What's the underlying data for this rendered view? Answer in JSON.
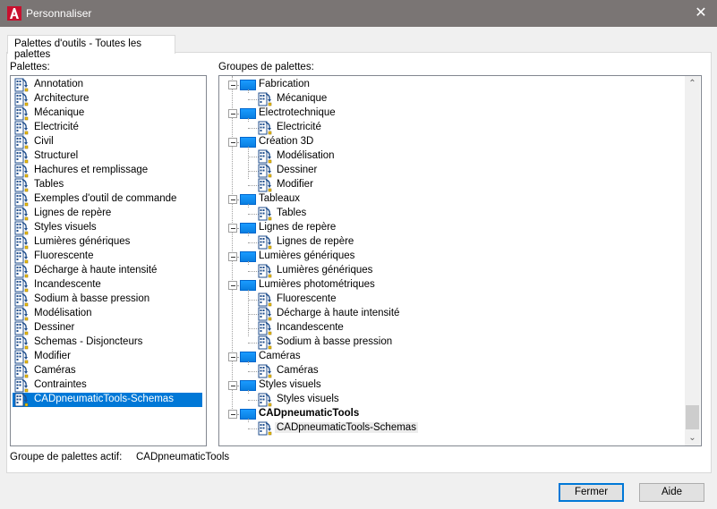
{
  "window": {
    "title": "Personnaliser",
    "close_label": "✕"
  },
  "tabs": [
    {
      "label": "Palettes d'outils - Toutes les palettes",
      "active": true
    }
  ],
  "palettes": {
    "label": "Palettes:",
    "items": [
      {
        "label": "Annotation"
      },
      {
        "label": "Architecture"
      },
      {
        "label": "Mécanique"
      },
      {
        "label": "Electricité"
      },
      {
        "label": "Civil"
      },
      {
        "label": "Structurel"
      },
      {
        "label": "Hachures et remplissage"
      },
      {
        "label": "Tables"
      },
      {
        "label": "Exemples d'outil de commande"
      },
      {
        "label": "Lignes de repère"
      },
      {
        "label": "Styles visuels"
      },
      {
        "label": "Lumières génériques"
      },
      {
        "label": "Fluorescente"
      },
      {
        "label": "Décharge à haute intensité"
      },
      {
        "label": "Incandescente"
      },
      {
        "label": "Sodium à basse pression"
      },
      {
        "label": "Modélisation"
      },
      {
        "label": "Dessiner"
      },
      {
        "label": "Schemas - Disjoncteurs"
      },
      {
        "label": "Modifier"
      },
      {
        "label": "Caméras"
      },
      {
        "label": "Contraintes"
      },
      {
        "label": "CADpneumaticTools-Schemas",
        "selected": true
      }
    ]
  },
  "groups": {
    "label": "Groupes de palettes:",
    "tree": [
      {
        "label": "Fabrication",
        "children": [
          "Mécanique"
        ]
      },
      {
        "label": "Electrotechnique",
        "children": [
          "Electricité"
        ]
      },
      {
        "label": "Création 3D",
        "children": [
          "Modélisation",
          "Dessiner",
          "Modifier"
        ]
      },
      {
        "label": "Tableaux",
        "children": [
          "Tables"
        ]
      },
      {
        "label": "Lignes de repère",
        "children": [
          "Lignes de repère"
        ]
      },
      {
        "label": "Lumières génériques",
        "children": [
          "Lumières génériques"
        ]
      },
      {
        "label": "Lumières photométriques",
        "children": [
          "Fluorescente",
          "Décharge à haute intensité",
          "Incandescente",
          "Sodium à basse pression"
        ]
      },
      {
        "label": "Caméras",
        "children": [
          "Caméras"
        ]
      },
      {
        "label": "Styles visuels",
        "children": [
          "Styles visuels"
        ]
      },
      {
        "label": "CADpneumaticTools",
        "bold": true,
        "children": [
          "CADpneumaticTools-Schemas"
        ],
        "highlight_child": 0
      }
    ],
    "scrollbar": {
      "up": "⌃",
      "down": "⌄"
    }
  },
  "active_group": {
    "label": "Groupe de palettes actif:",
    "value": "CADpneumaticTools"
  },
  "buttons": {
    "close": "Fermer",
    "help": "Aide"
  },
  "colors": {
    "titlebar": "#7a7574",
    "selection": "#0078d7",
    "group_icon": "#1a9bff"
  }
}
